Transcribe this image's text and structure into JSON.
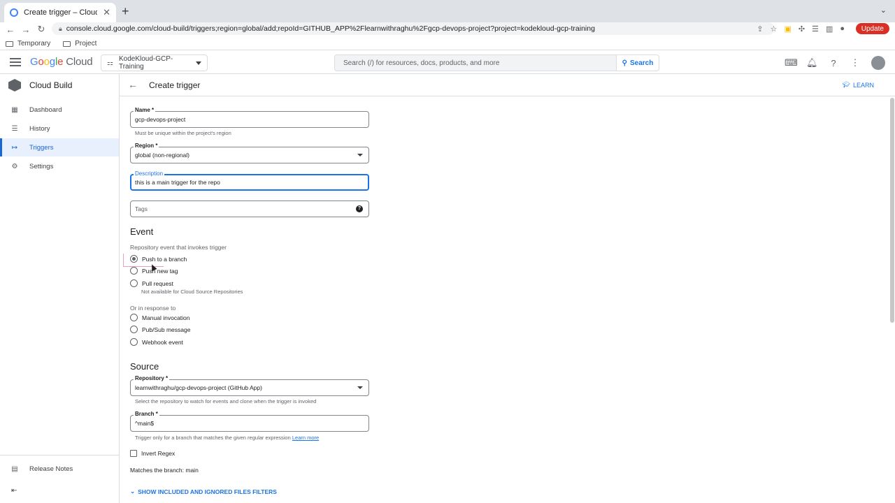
{
  "browser": {
    "tab_title": "Create trigger – Cloud Build – K",
    "url": "console.cloud.google.com/cloud-build/triggers;region=global/add;repoId=GITHUB_APP%2Flearnwithraghu%2Fgcp-devops-project?project=kodekloud-gcp-training",
    "update_label": "Update",
    "bookmarks": [
      "Temporary",
      "Project"
    ]
  },
  "header": {
    "logo_google": [
      "G",
      "o",
      "o",
      "g",
      "l",
      "e"
    ],
    "logo_cloud": "Cloud",
    "project": "KodeKloud-GCP-Training",
    "search_placeholder": "Search (/) for resources, docs, products, and more",
    "search_button": "Search"
  },
  "sidebar": {
    "product": "Cloud Build",
    "items": [
      {
        "label": "Dashboard",
        "icon": "dashboard-icon"
      },
      {
        "label": "History",
        "icon": "list-icon"
      },
      {
        "label": "Triggers",
        "icon": "arrows-icon",
        "active": true
      },
      {
        "label": "Settings",
        "icon": "gear-icon"
      }
    ],
    "release_notes": "Release Notes"
  },
  "page": {
    "title": "Create trigger",
    "learn": "LEARN"
  },
  "form": {
    "name": {
      "label": "Name *",
      "value": "gcp-devops-project",
      "hint": "Must be unique within the project's region"
    },
    "region": {
      "label": "Region *",
      "value": "global (non-regional)"
    },
    "description": {
      "label": "Description",
      "value": "this is a main trigger for the repo"
    },
    "tags": {
      "placeholder": "Tags"
    },
    "event": {
      "heading": "Event",
      "sub": "Repository event that invokes trigger",
      "options": [
        {
          "label": "Push to a branch",
          "selected": true
        },
        {
          "label": "Push new tag",
          "selected": false
        },
        {
          "label": "Pull request",
          "selected": false,
          "note": "Not available for Cloud Source Repositories"
        }
      ],
      "response_sub": "Or in response to",
      "response_options": [
        {
          "label": "Manual invocation"
        },
        {
          "label": "Pub/Sub message"
        },
        {
          "label": "Webhook event"
        }
      ]
    },
    "source": {
      "heading": "Source",
      "repository": {
        "label": "Repository *",
        "value": "learnwithraghu/gcp-devops-project (GitHub App)",
        "hint": "Select the repository to watch for events and clone when the trigger is invoked"
      },
      "branch": {
        "label": "Branch *",
        "value": "^main$",
        "hint": "Trigger only for a branch that matches the given regular expression",
        "hint_link": "Learn more"
      },
      "invert_regex": "Invert Regex",
      "matches": "Matches the branch: main",
      "show_filters": "SHOW INCLUDED AND IGNORED FILES FILTERS"
    }
  }
}
